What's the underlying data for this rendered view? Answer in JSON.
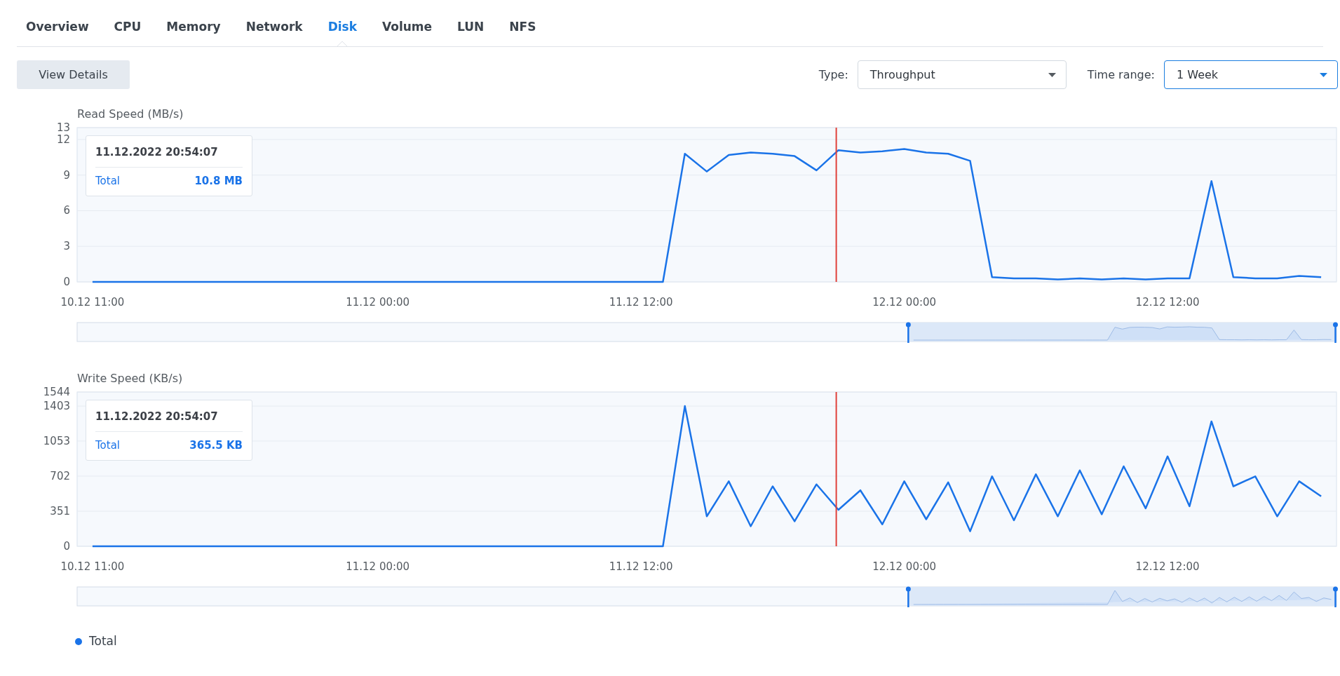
{
  "tabs": [
    {
      "label": "Overview",
      "selected": false
    },
    {
      "label": "CPU",
      "selected": false
    },
    {
      "label": "Memory",
      "selected": false
    },
    {
      "label": "Network",
      "selected": false
    },
    {
      "label": "Disk",
      "selected": true
    },
    {
      "label": "Volume",
      "selected": false
    },
    {
      "label": "LUN",
      "selected": false
    },
    {
      "label": "NFS",
      "selected": false
    }
  ],
  "toolbar": {
    "button": "View Details",
    "filters": [
      {
        "label": "Type:",
        "value": "Throughput",
        "focused": false
      },
      {
        "label": "Time range:",
        "value": "1 Week",
        "focused": true
      }
    ]
  },
  "charts": [
    {
      "title": "Read Speed (MB/s)",
      "tooltip": {
        "time": "11.12.2022 20:54:07",
        "label": "Total",
        "value": "10.8 MB"
      },
      "navigator": {
        "level": 0.34
      },
      "chart_data": {
        "type": "line",
        "ylim": [
          0,
          13
        ],
        "yticks": [
          0,
          3,
          6,
          9,
          12,
          13
        ],
        "categories": [
          "10.12 11:00",
          null,
          null,
          null,
          null,
          null,
          null,
          null,
          null,
          null,
          null,
          null,
          null,
          "11.12 00:00",
          null,
          null,
          null,
          null,
          null,
          null,
          null,
          null,
          null,
          null,
          null,
          "11.12 12:00",
          null,
          null,
          null,
          null,
          null,
          null,
          null,
          null,
          null,
          null,
          null,
          "12.12 00:00",
          null,
          null,
          null,
          null,
          null,
          null,
          null,
          null,
          null,
          null,
          null,
          "12.12 12:00",
          null,
          null,
          null,
          null,
          null,
          null,
          null
        ],
        "series": [
          {
            "color": "#1a73e8",
            "values": [
              0,
              0,
              0,
              0,
              0,
              0,
              0,
              0,
              0,
              0,
              0,
              0,
              0,
              0,
              0,
              0,
              0,
              0,
              0,
              0,
              0,
              0,
              0,
              0,
              0,
              0,
              0,
              10.8,
              9.3,
              10.7,
              10.9,
              10.8,
              10.6,
              9.4,
              11.1,
              10.9,
              11,
              11.2,
              10.9,
              10.8,
              10.2,
              0.4,
              0.3,
              0.3,
              0.2,
              0.3,
              0.2,
              0.3,
              0.2,
              0.3,
              0.3,
              8.5,
              0.4,
              0.3,
              0.3,
              0.5,
              0.4
            ]
          }
        ],
        "grid": true
      }
    },
    {
      "title": "Write Speed (KB/s)",
      "tooltip": {
        "time": "11.12.2022 20:54:07",
        "label": "Total",
        "value": "365.5 KB"
      },
      "navigator": {
        "level": 0.34
      },
      "chart_data": {
        "type": "line",
        "ylim": [
          0,
          1544
        ],
        "yticks": [
          0,
          351,
          702,
          1053,
          1403,
          1544
        ],
        "categories": [
          "10.12 11:00",
          null,
          null,
          null,
          null,
          null,
          null,
          null,
          null,
          null,
          null,
          null,
          null,
          "11.12 00:00",
          null,
          null,
          null,
          null,
          null,
          null,
          null,
          null,
          null,
          null,
          null,
          "11.12 12:00",
          null,
          null,
          null,
          null,
          null,
          null,
          null,
          null,
          null,
          null,
          null,
          "12.12 00:00",
          null,
          null,
          null,
          null,
          null,
          null,
          null,
          null,
          null,
          null,
          null,
          "12.12 12:00",
          null,
          null,
          null,
          null,
          null,
          null,
          null
        ],
        "series": [
          {
            "color": "#1a73e8",
            "values": [
              0,
              0,
              0,
              0,
              0,
              0,
              0,
              0,
              0,
              0,
              0,
              0,
              0,
              0,
              0,
              0,
              0,
              0,
              0,
              0,
              0,
              0,
              0,
              0,
              0,
              0,
              0,
              1403,
              300,
              650,
              200,
              600,
              250,
              620,
              365,
              560,
              220,
              650,
              270,
              640,
              150,
              700,
              260,
              720,
              300,
              760,
              320,
              800,
              380,
              900,
              400,
              1250,
              600,
              700,
              300,
              650,
              500
            ]
          }
        ],
        "grid": true
      }
    }
  ],
  "legend": [
    {
      "label": "Total",
      "color": "#1a73e8"
    }
  ]
}
